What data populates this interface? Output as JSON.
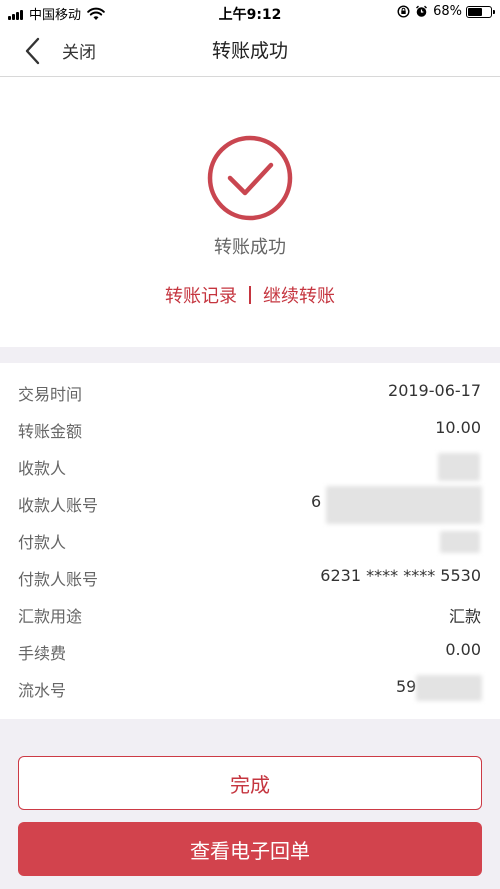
{
  "status_bar": {
    "carrier": "中国移动",
    "time": "上午9:12",
    "battery": "68%",
    "battery_level": 0.68
  },
  "nav": {
    "close_label": "关闭",
    "title": "转账成功"
  },
  "success": {
    "message": "转账成功",
    "record_link": "转账记录",
    "continue_link": "继续转账",
    "accent_color": "#c5353f"
  },
  "details": {
    "rows": [
      {
        "label": "交易时间",
        "value": "2019-06-17"
      },
      {
        "label": "转账金额",
        "value": "10.00"
      },
      {
        "label": "收款人",
        "value": ""
      },
      {
        "label": "收款人账号",
        "value": "6"
      },
      {
        "label": "付款人",
        "value": ""
      },
      {
        "label": "付款人账号",
        "value": "6231 **** **** 5530"
      },
      {
        "label": "汇款用途",
        "value": "汇款"
      },
      {
        "label": "手续费",
        "value": "0.00"
      },
      {
        "label": "流水号",
        "value": "59"
      }
    ]
  },
  "buttons": {
    "done": "完成",
    "receipt": "查看电子回单"
  },
  "icons": {
    "back": "chevron-left-icon",
    "success": "check-circle-icon",
    "wifi": "wifi-icon",
    "lock_rotation": "orientation-lock-icon",
    "alarm": "alarm-icon",
    "battery": "battery-icon"
  }
}
